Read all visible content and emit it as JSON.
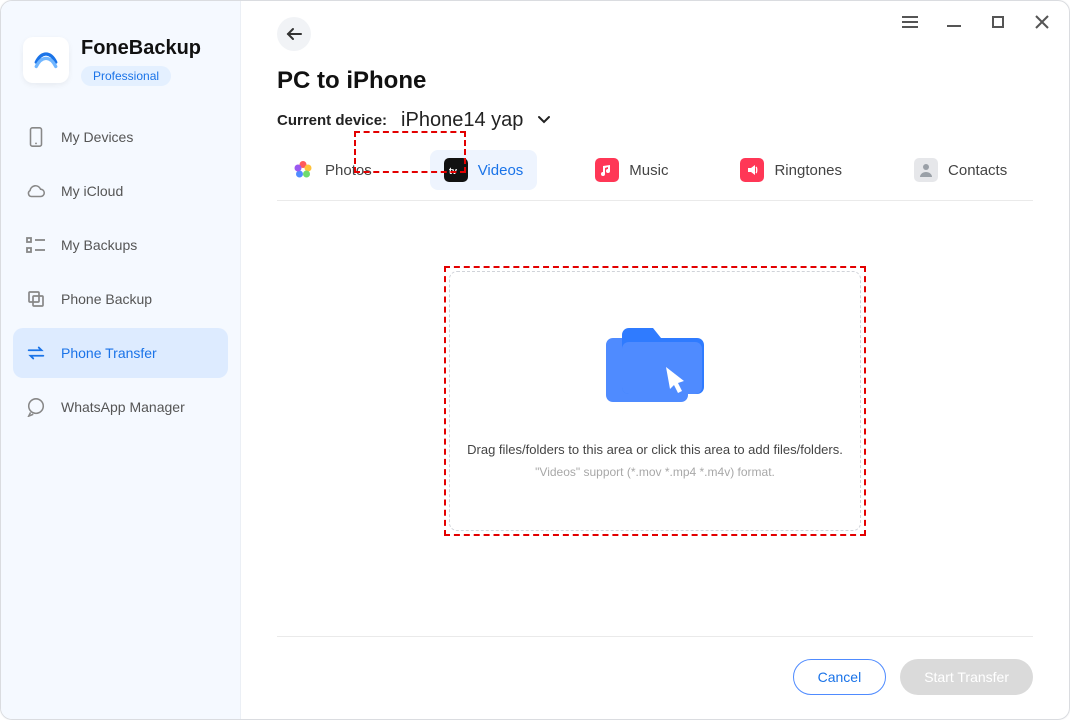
{
  "brand": {
    "name": "FoneBackup",
    "tier": "Professional"
  },
  "sidebar": {
    "items": [
      {
        "label": "My Devices"
      },
      {
        "label": "My iCloud"
      },
      {
        "label": "My Backups"
      },
      {
        "label": "Phone Backup"
      },
      {
        "label": "Phone Transfer"
      },
      {
        "label": "WhatsApp Manager"
      }
    ]
  },
  "header": {
    "title": "PC to iPhone",
    "current_device_label": "Current device:",
    "current_device_name": "iPhone14 yap"
  },
  "tabs": {
    "items": [
      {
        "label": "Photos"
      },
      {
        "label": "Videos"
      },
      {
        "label": "Music"
      },
      {
        "label": "Ringtones"
      },
      {
        "label": "Contacts"
      }
    ],
    "active_index": 1
  },
  "drop": {
    "line1": "Drag files/folders to this area or click this area to add files/folders.",
    "line2": "\"Videos\" support (*.mov *.mp4 *.m4v) format."
  },
  "footer": {
    "cancel": "Cancel",
    "start": "Start Transfer"
  },
  "colors": {
    "accent": "#1A73E8",
    "highlight": "#E30000"
  }
}
